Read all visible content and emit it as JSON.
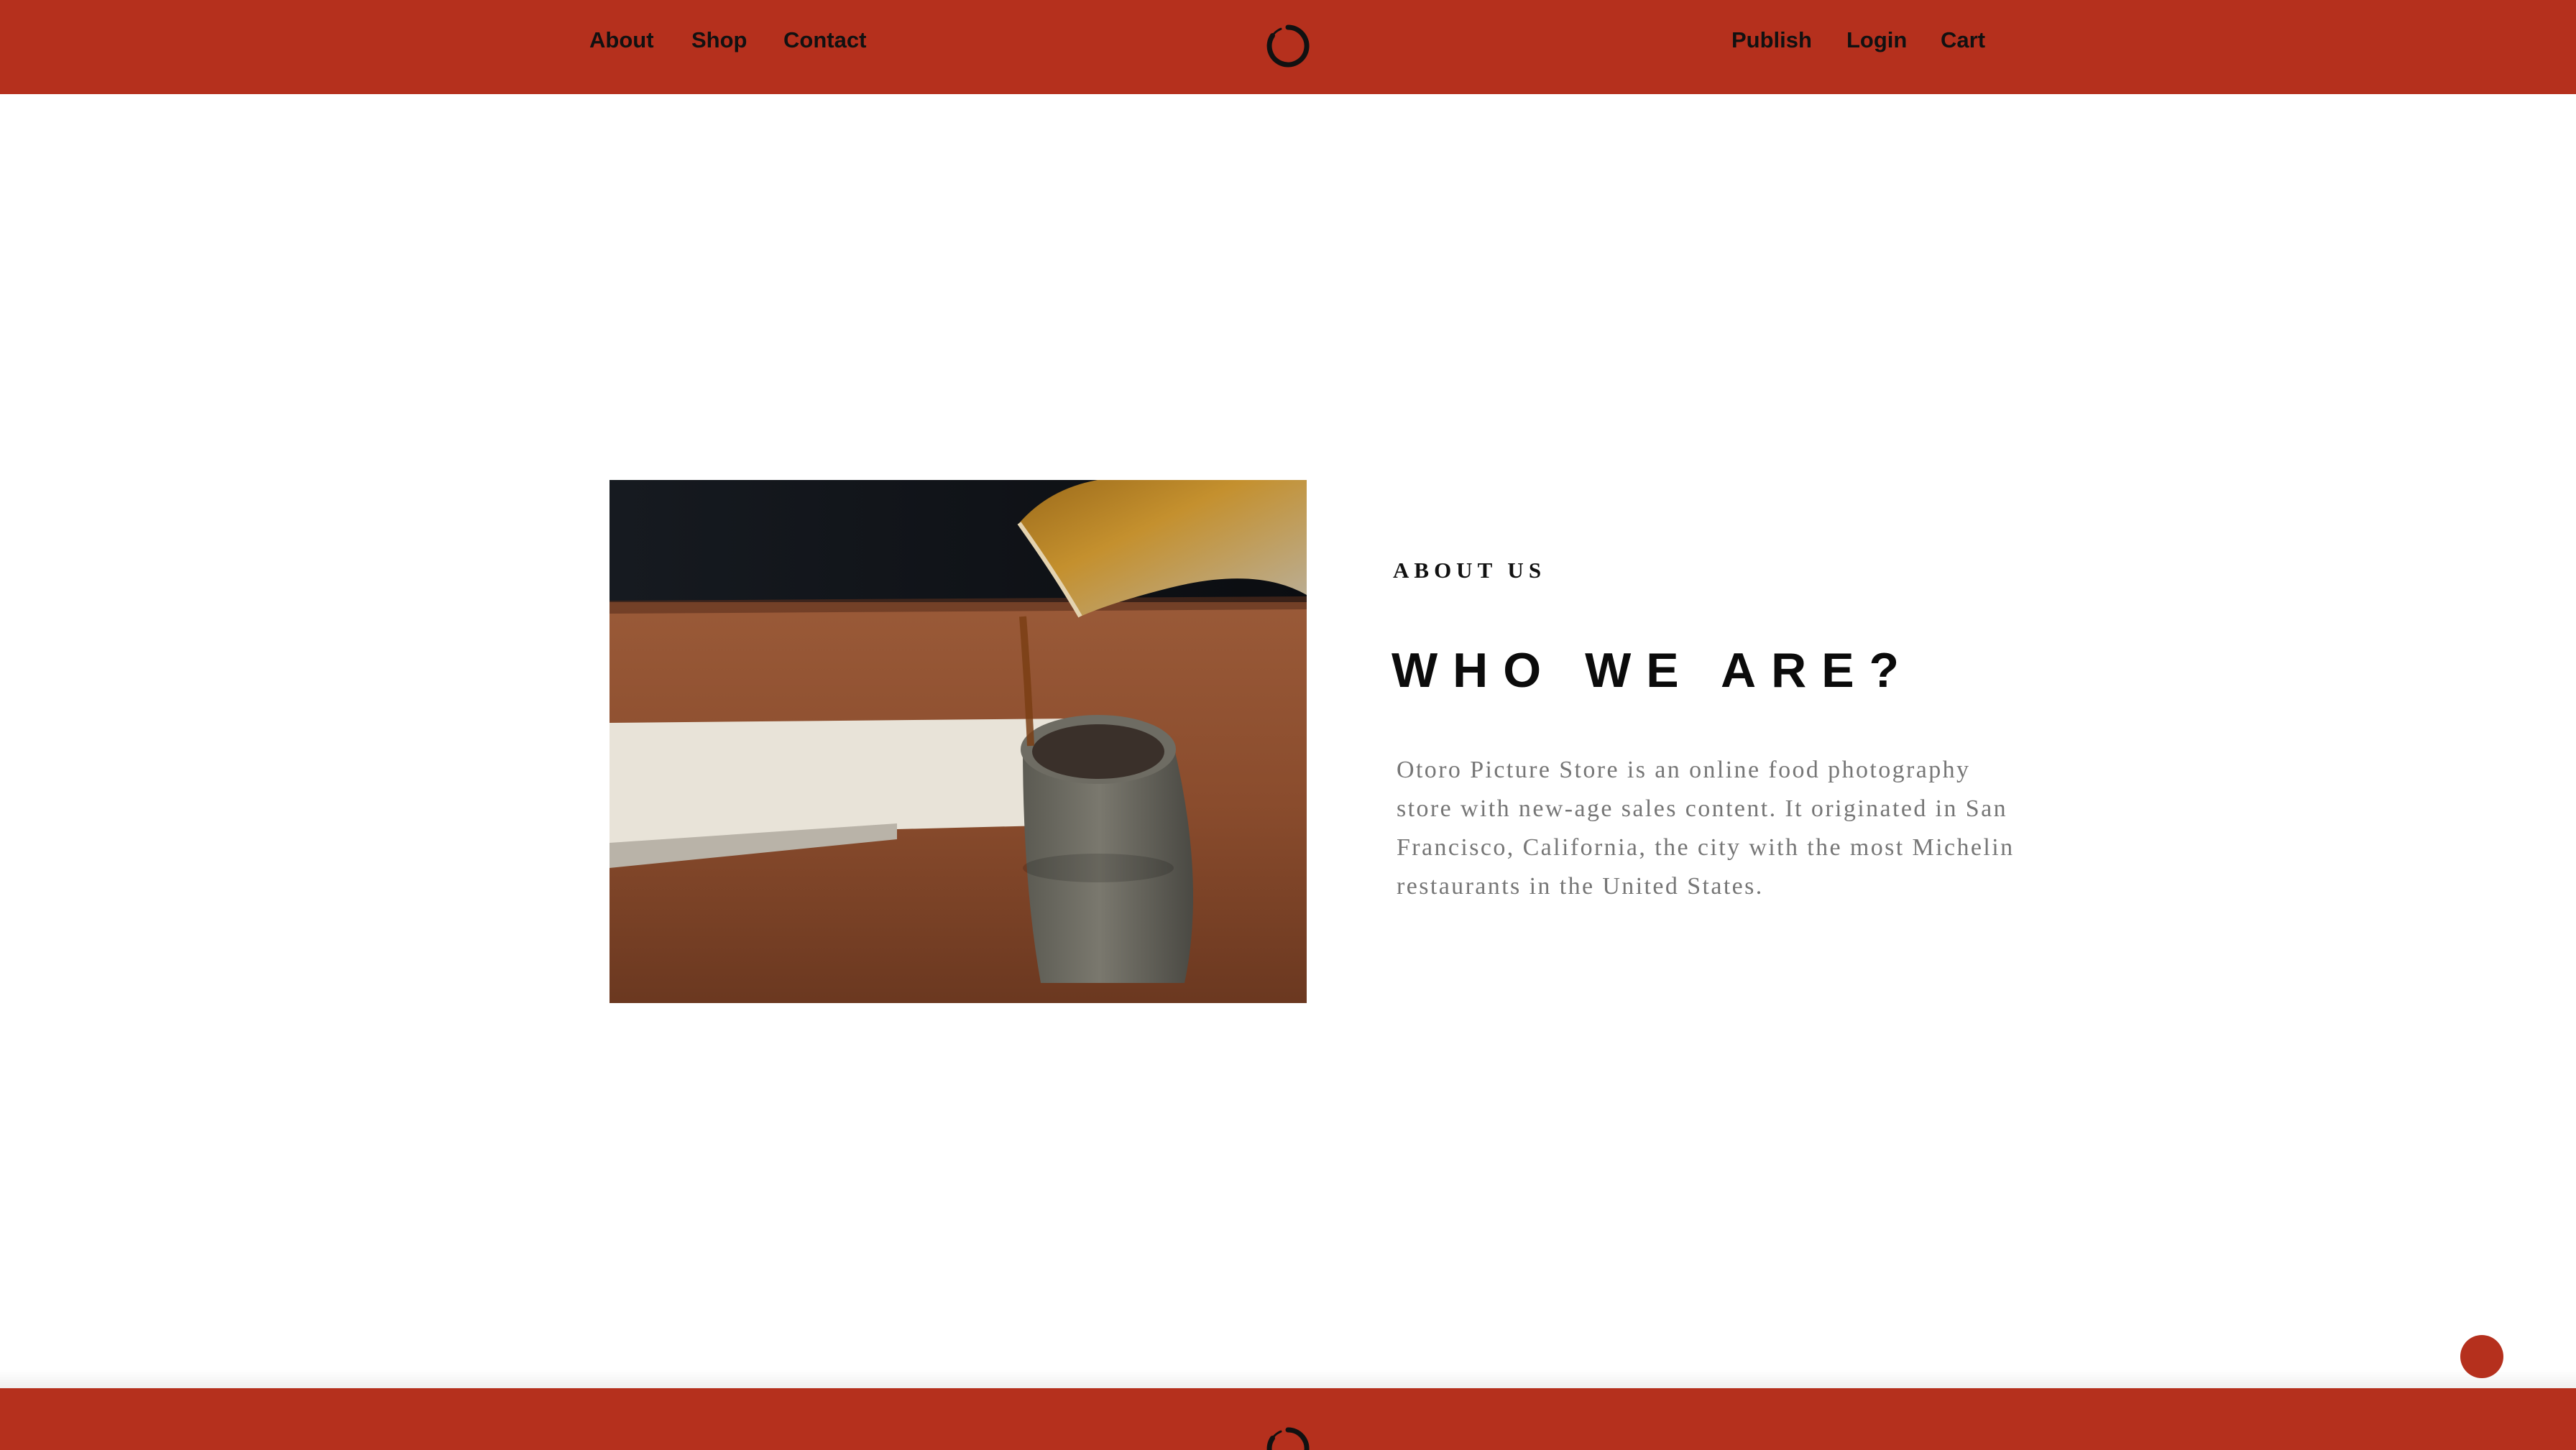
{
  "nav": {
    "left": [
      {
        "label": "About"
      },
      {
        "label": "Shop"
      },
      {
        "label": "Contact"
      }
    ],
    "right": [
      {
        "label": "Publish"
      },
      {
        "label": "Login"
      },
      {
        "label": "Cart"
      }
    ]
  },
  "about": {
    "eyebrow": "ABOUT US",
    "headline": "WHO WE ARE?",
    "body": "Otoro Picture Store is an online food photography store with new-age sales content. It originated in San Francisco, California, the city with the most Michelin restaurants in the United States."
  },
  "colors": {
    "brand": "#b5301d",
    "text_dark": "#111111",
    "text_muted": "#767676"
  },
  "icons": {
    "logo": "enso-ring-logo-icon",
    "floating_button": "circle-button"
  }
}
